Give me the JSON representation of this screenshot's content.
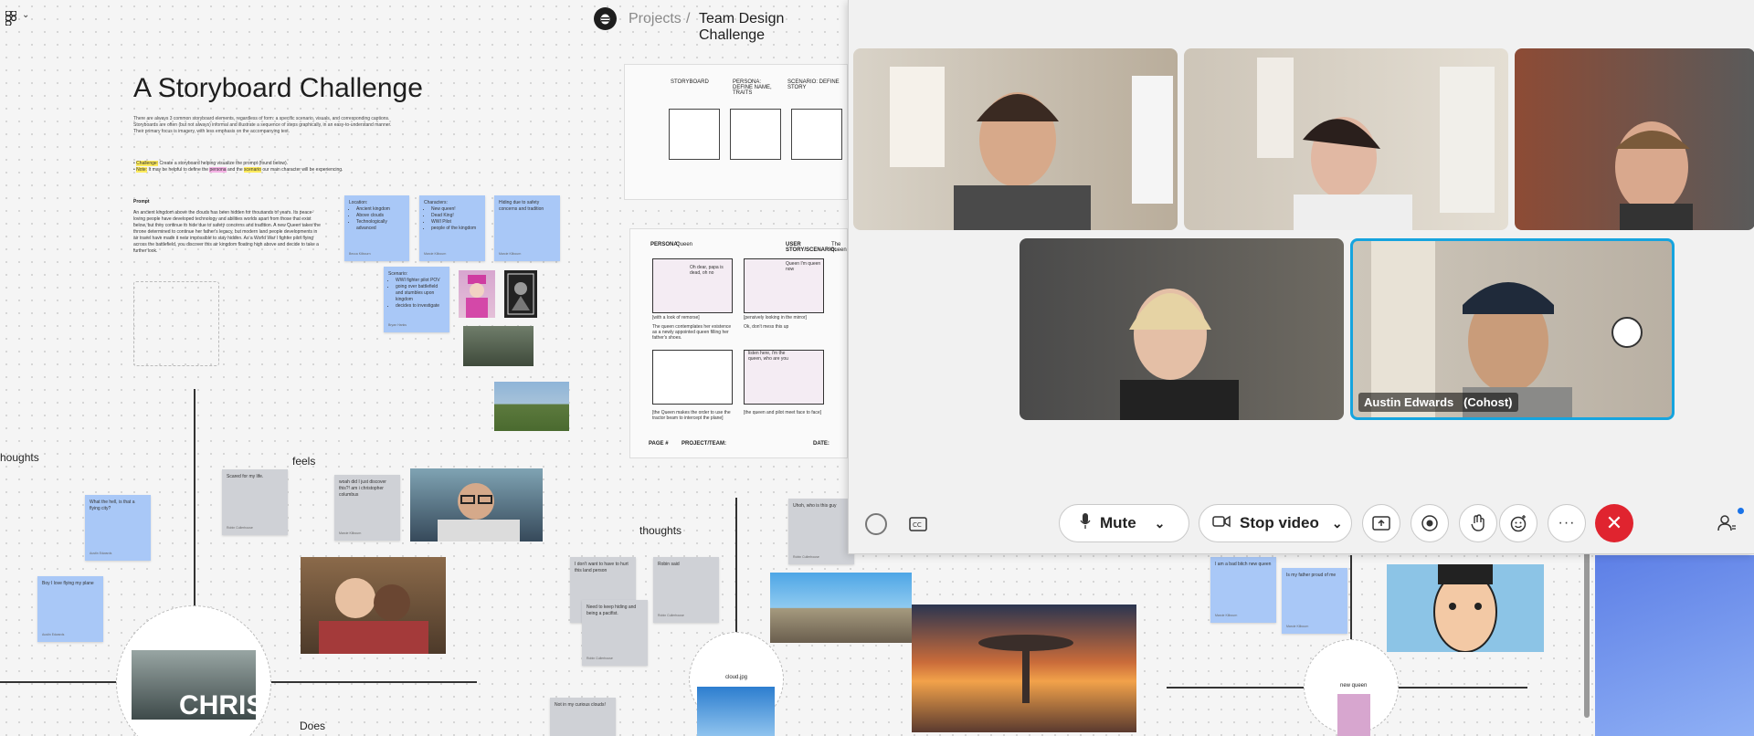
{
  "breadcrumb": {
    "projects": "Projects",
    "separator": "/",
    "title": "Team Design Challenge"
  },
  "doc": {
    "title": "A Storyboard Challenge",
    "intro": "There are always 3 common storyboard elements, regardless of form: a specific scenario, visuals, and corresponding captions. Storyboards are often (but not always) informal and illustrate a sequence of steps graphically, in an easy-to-understand manner. Their primary focus is imagery, with less emphasis on the accompanying text.",
    "challenge_label": "Challenge:",
    "challenge_text": "Create a storyboard helping visualize the prompt (found below).",
    "note_label": "Note:",
    "note_text_1": "It may be helpful to define the",
    "note_persona": "persona",
    "note_text_2": "and the",
    "note_scenario": "scenario",
    "note_text_3": "our main character will be experiencing.",
    "prompt_heading": "Prompt",
    "prompt_text": "An ancient kingdom above the clouds has been hidden for thousands of years. Its peace-loving people have developed technology and abilities worlds apart from those that exist below, but they continue to hide due to safety concerns and tradition. A new Queen takes the throne determined to continue her father's legacy, but modern land people developments in air travel have made it near impossible to stay hidden. As a World War I fighter pilot flying across the battlefield, you discover this air kingdom floating high above and decide to take a further look."
  },
  "stickies": {
    "location": {
      "title": "Location:",
      "items": [
        "Ancient kingdom",
        "Above clouds",
        "Technologically advanced"
      ],
      "author": "Becca Kilbourn"
    },
    "characters": {
      "title": "Characters:",
      "items": [
        "New queen!",
        "Dead King!",
        "WWI Pilot",
        "people of the kingdom"
      ],
      "author": "Marcie Kilbourn"
    },
    "hiding": {
      "text": "Hiding due to safety concerns and tradition",
      "author": "Marcie Kilbourn"
    },
    "scenario": {
      "title": "Scenario:",
      "items": [
        "WWI fighter pilot POV",
        "going over battlefield and stumbles upon kingdom",
        "decides to investigate"
      ],
      "author": "Bryan Hanks"
    },
    "flying_city": {
      "text": "What the hell, is that a flying city?",
      "author": "Austin Edwards"
    },
    "scared": {
      "text": "Scared for my life.",
      "author": "Robin Cullerhouse"
    },
    "discover": {
      "text": "woah did I just discover this?! am i christopher columbus",
      "author": "Marcie Kilbourn"
    },
    "love_plane": {
      "text": "Boy I love flying my plane",
      "author": "Austin Edwards"
    },
    "hurt": {
      "text": "I don't want to have to hurt this land person",
      "author": ""
    },
    "hiding_pacifist": {
      "text": "Need to keep hiding and being a pacifist.",
      "author": "Robin Cullerhouse"
    },
    "grey_small": {
      "text": "Robin said",
      "author": "Robin Cullerhouse"
    },
    "uhoh": {
      "text": "Uhoh, who is this guy",
      "author": "Robin Cullerhouse"
    },
    "curious": {
      "text": "Not in my curious clouds!",
      "author": ""
    },
    "bad_queen": {
      "text": "I am a bad bitch new queen",
      "author": "Marcie Kilbourn"
    },
    "father": {
      "text": "Is my father proud of me",
      "author": "Marcie Kilbourn"
    }
  },
  "labels": {
    "thoughts_left": "houghts",
    "feels": "feels",
    "thoughts_mid": "thoughts",
    "does": "Does",
    "chris": "CHRIS",
    "cloud_jpg": "cloud.jpg",
    "new_queen": "new queen"
  },
  "template": {
    "col1": "STORYBOARD",
    "col2": "PERSONA: DEFINE NAME, TRAITS",
    "col3": "SCENARIO: DEFINE STORY",
    "persona_label": "PERSONA:",
    "persona_value": "Queen",
    "story_label": "USER STORY/SCENARIO:",
    "story_value": "The queen",
    "page_label": "PAGE #",
    "project_label": "PROJECT/TEAM:",
    "date_label": "DATE:",
    "frames": [
      {
        "bubble": "Oh dear, papa is dead, oh no",
        "caption": "[with a look of remorse]"
      },
      {
        "bubble": "Queen I'm queen now",
        "caption": "[pensively looking in the mirror]"
      },
      {
        "bubble": "",
        "caption": "The queen contemplates her existence as a newly appointed queen filling her father's shoes."
      },
      {
        "bubble": "",
        "caption": "Ok, don't mess this up"
      },
      {
        "bubble": "",
        "caption": "[the Queen makes the order to use the tractor beam to intercept the plane]"
      },
      {
        "bubble": "listen here, i'm the queen, who are you",
        "caption": "[the queen and pilot meet face to face]"
      }
    ]
  },
  "zoom": {
    "participants": [
      {
        "name": ""
      },
      {
        "name": ""
      },
      {
        "name": ""
      },
      {
        "name": ""
      },
      {
        "name": "Austin Edwards   (Cohost)"
      }
    ],
    "controls": {
      "mute": "Mute",
      "stop_video": "Stop video"
    },
    "colors": {
      "active_border": "#16a4de",
      "leave": "#e0242f",
      "notify_dot": "#1a73e8"
    }
  }
}
